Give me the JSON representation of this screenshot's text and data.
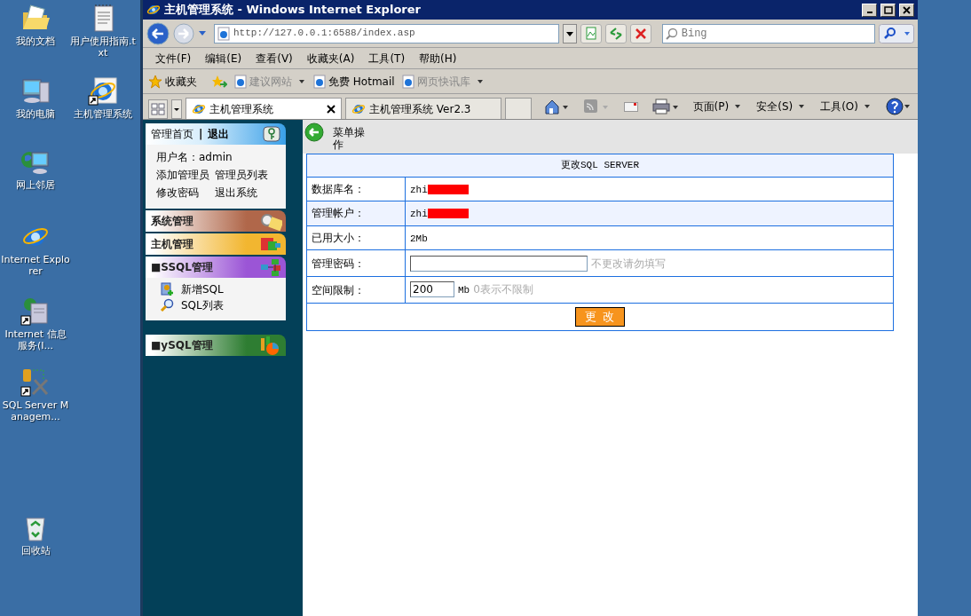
{
  "desktop": {
    "icons": [
      {
        "label": "我的文档",
        "kind": "folder"
      },
      {
        "label": "用户使用指南.txt",
        "kind": "notepad"
      },
      {
        "label": "我的电脑",
        "kind": "computer"
      },
      {
        "label": "主机管理系统",
        "kind": "browser-shortcut"
      },
      {
        "label": "网上邻居",
        "kind": "network"
      },
      {
        "label": "Internet Explorer",
        "kind": "browser"
      },
      {
        "label": "Internet 信息服务(I...",
        "kind": "server-shortcut"
      },
      {
        "label": "SQL Server Managem...",
        "kind": "tools-shortcut"
      },
      {
        "label": "回收站",
        "kind": "recycle"
      }
    ]
  },
  "window": {
    "title": "主机管理系统 - Windows Internet Explorer",
    "address": "http://127.0.0.1:6588/index.asp",
    "search": {
      "placeholder": "Bing"
    },
    "menu": [
      "文件(F)",
      "编辑(E)",
      "查看(V)",
      "收藏夹(A)",
      "工具(T)",
      "帮助(H)"
    ],
    "favorites": {
      "label": "收藏夹",
      "items": [
        {
          "label": "建议网站",
          "disabled": true,
          "dropdown": true
        },
        {
          "label": "免费 Hotmail",
          "disabled": false,
          "dropdown": false
        },
        {
          "label": "网页快讯库",
          "disabled": true,
          "dropdown": true
        }
      ]
    },
    "tabs": [
      {
        "label": "主机管理系统",
        "selected": true
      },
      {
        "label": "主机管理系统 Ver2.3",
        "selected": false
      }
    ],
    "commands": [
      "页面(P)",
      "安全(S)",
      "工具(O)"
    ]
  },
  "nav": {
    "home": "管理首页",
    "separator": "|",
    "logout": "退出",
    "user": "用户名：admin",
    "links": [
      "添加管理员",
      "管理员列表",
      "修改密码",
      "退出系统"
    ],
    "sections": [
      {
        "title": "系统管理",
        "color": "#b0674a"
      },
      {
        "title": "主机管理",
        "color": "#f2b630"
      },
      {
        "title": "■SSQL管理",
        "color": "#9b55d6",
        "items": [
          {
            "label": "新增SQL",
            "kind": "add-user"
          },
          {
            "label": "SQL列表",
            "kind": "search"
          }
        ]
      },
      {
        "title": "■ySQL管理",
        "color": "#2e7d32"
      }
    ]
  },
  "main": {
    "header": "菜单操作",
    "form": {
      "title": "更改SQL SERVER",
      "rows": [
        {
          "label": "数据库名：",
          "kind": "text",
          "value": "zhi",
          "redacted": true
        },
        {
          "label": "管理帐户：",
          "kind": "text",
          "value": "zhi",
          "redacted": true
        },
        {
          "label": "已用大小：",
          "kind": "text",
          "value": "2Mb",
          "redacted": false
        },
        {
          "label": "管理密码：",
          "kind": "input",
          "note": "不更改请勿填写"
        },
        {
          "label": "空间限制：",
          "kind": "input",
          "value": "200",
          "unit": "Mb",
          "note": "0表示不限制"
        }
      ],
      "submit": "更 改"
    }
  }
}
